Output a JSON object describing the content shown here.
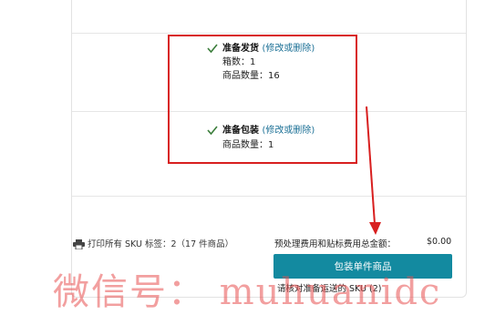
{
  "shipment": {
    "title": "准备发货",
    "edit_link": "(修改或删除)",
    "boxes_line": "箱数：1",
    "items_line": "商品数量：16"
  },
  "packing": {
    "title": "准备包装",
    "edit_link": "(修改或删除)",
    "items_line": "商品数量：1"
  },
  "print_labels": {
    "label": "打印所有 SKU 标签：2（17 件商品）"
  },
  "fees": {
    "label": "预处理费用和贴标费用总金额：",
    "amount": "$0.00"
  },
  "primary_button": {
    "label": "包装单件商品"
  },
  "review_note": "请核对准备运送的 SKU (2)",
  "watermark": "微信号： muhuanidc",
  "colors": {
    "accent": "#138aa0",
    "annotation_red": "#d81f1f",
    "link": "#1a6f95"
  },
  "icons": [
    "checkmark-icon",
    "printer-icon"
  ]
}
